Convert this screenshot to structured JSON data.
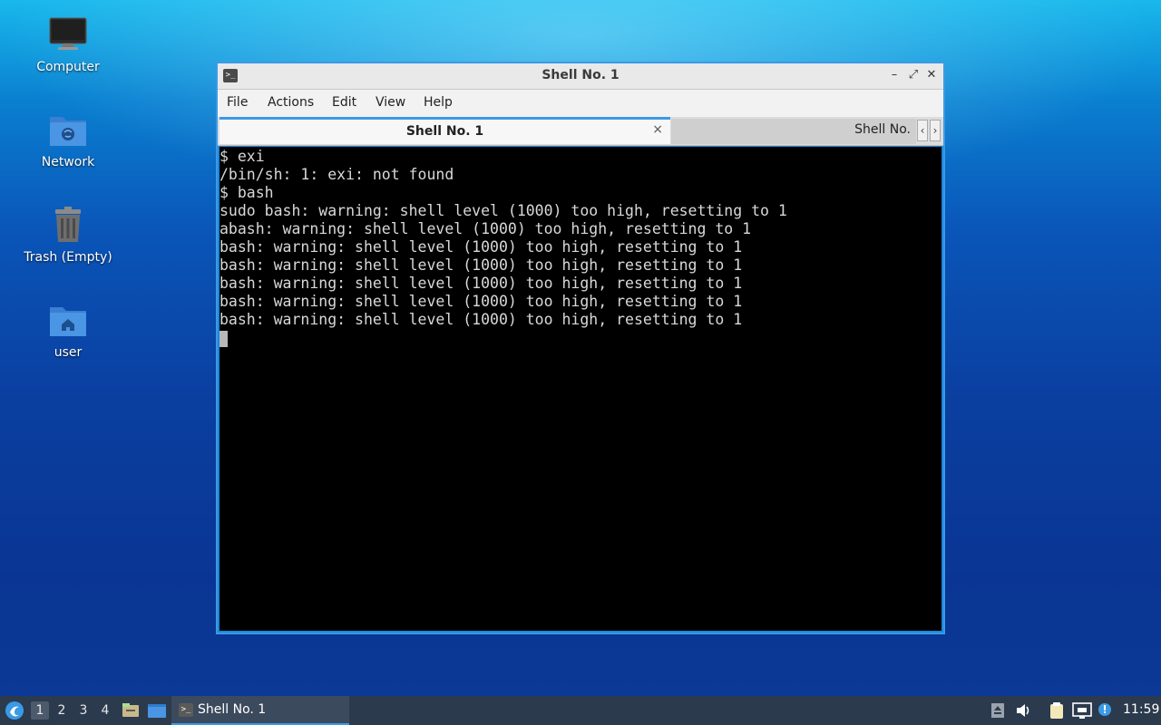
{
  "desktop": {
    "icons": [
      {
        "label": "Computer",
        "icon": "monitor-icon"
      },
      {
        "label": "Network",
        "icon": "network-folder-icon"
      },
      {
        "label": "Trash (Empty)",
        "icon": "trash-icon"
      },
      {
        "label": "user",
        "icon": "home-folder-icon"
      }
    ]
  },
  "window": {
    "title": "Shell No. 1",
    "controls": {
      "minimize": "–",
      "maximize": "⤢",
      "close": "✕"
    },
    "menu": [
      "File",
      "Actions",
      "Edit",
      "View",
      "Help"
    ],
    "tabs": [
      {
        "label": "Shell No. 1",
        "active": true,
        "close": "×"
      },
      {
        "label": "Shell No.",
        "active": false
      }
    ],
    "tab_scroll": {
      "left": "‹",
      "right": "›"
    },
    "terminal_lines": [
      "$ exi",
      "/bin/sh: 1: exi: not found",
      "$ bash",
      "sudo bash: warning: shell level (1000) too high, resetting to 1",
      "abash: warning: shell level (1000) too high, resetting to 1",
      "bash: warning: shell level (1000) too high, resetting to 1",
      "bash: warning: shell level (1000) too high, resetting to 1",
      "bash: warning: shell level (1000) too high, resetting to 1",
      "bash: warning: shell level (1000) too high, resetting to 1",
      "bash: warning: shell level (1000) too high, resetting to 1"
    ]
  },
  "taskbar": {
    "workspaces": [
      "1",
      "2",
      "3",
      "4"
    ],
    "active_workspace": "1",
    "task": {
      "label": "Shell No. 1"
    },
    "clock": "11:59"
  },
  "colors": {
    "accent": "#3b9ae6",
    "taskbar": "#2c3a4e"
  }
}
